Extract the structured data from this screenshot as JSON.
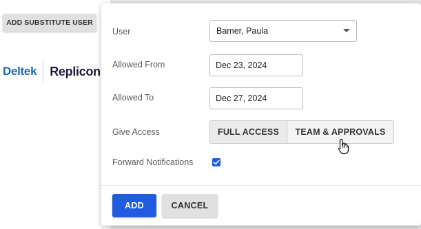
{
  "trigger": {
    "label": "ADD SUBSTITUTE USER"
  },
  "logo": {
    "brand": "Deltek",
    "product": "Replicon"
  },
  "form": {
    "user": {
      "label": "User",
      "value": "Bamer, Paula"
    },
    "allowed_from": {
      "label": "Allowed From",
      "value": "Dec 23, 2024"
    },
    "allowed_to": {
      "label": "Allowed To",
      "value": "Dec 27, 2024"
    },
    "give_access": {
      "label": "Give Access",
      "options": [
        "FULL ACCESS",
        "TEAM & APPROVALS"
      ],
      "selected": "FULL ACCESS"
    },
    "forward_notifications": {
      "label": "Forward Notifications",
      "checked": true
    }
  },
  "actions": {
    "add_label": "ADD",
    "cancel_label": "CANCEL"
  },
  "colors": {
    "primary": "#1f5ce0",
    "brand_blue": "#1f67b1",
    "brand_dark": "#1c1c3c"
  },
  "icons": {
    "dropdown": "chevron-down-icon",
    "check": "check-icon",
    "cursor": "hand-pointer-icon"
  }
}
